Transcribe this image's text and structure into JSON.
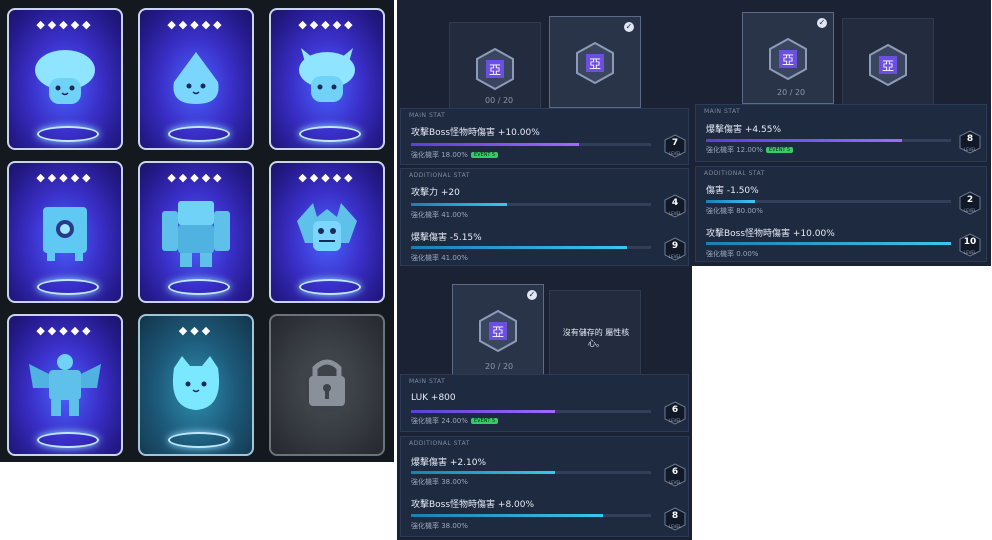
{
  "cards": [
    {
      "stars": "◆◆◆◆◆",
      "monster": "mushroom",
      "locked": false
    },
    {
      "stars": "◆◆◆◆◆",
      "monster": "slime",
      "locked": false
    },
    {
      "stars": "◆◆◆◆◆",
      "monster": "horned-mushroom",
      "locked": false
    },
    {
      "stars": "◆◆◆◆◆",
      "monster": "block-golem",
      "locked": false
    },
    {
      "stars": "◆◆◆◆◆",
      "monster": "stone-golem",
      "locked": false
    },
    {
      "stars": "◆◆◆◆◆",
      "monster": "balrog",
      "locked": false
    },
    {
      "stars": "◆◆◆◆◆",
      "monster": "robot",
      "locked": false
    },
    {
      "stars": "◆◆◆",
      "monster": "cat-slime",
      "locked": false
    },
    {
      "stars": "",
      "monster": "lock-icon",
      "locked": true
    }
  ],
  "panel_a": {
    "count": "00 / 20",
    "main_title": "MAIN STAT",
    "main_stat": "攻擊Boss怪物時傷害 +10.00%",
    "main_sub": "強化機率 18.00%",
    "main_event": "EVENT 5",
    "main_level": "7",
    "main_fill": 0.7,
    "add_title": "ADDITIONAL STAT",
    "add1_stat": "攻擊力 +20",
    "add1_sub": "強化機率 41.00%",
    "add1_level": "4",
    "add1_fill": 0.4,
    "add2_stat": "爆擊傷害 -5.15%",
    "add2_sub": "強化機率 41.00%",
    "add2_level": "9",
    "add2_fill": 0.9,
    "level_label": "LEVEL"
  },
  "panel_b": {
    "count": "20 / 20",
    "main_title": "MAIN STAT",
    "main_stat": "爆擊傷害 +4.55%",
    "main_sub": "強化機率 12.00%",
    "main_event": "EVENT 5",
    "main_level": "8",
    "main_fill": 0.8,
    "add_title": "ADDITIONAL STAT",
    "add1_stat": "傷害 -1.50%",
    "add1_sub": "強化機率 80.00%",
    "add1_level": "2",
    "add1_fill": 0.2,
    "add2_stat": "攻擊Boss怪物時傷害 +10.00%",
    "add2_sub": "強化機率 0.00%",
    "add2_level": "10",
    "add2_fill": 1.0,
    "level_label": "LEVEL"
  },
  "panel_c": {
    "count": "20 / 20",
    "empty_text": "沒有儲存的 屬性核心。",
    "main_title": "MAIN STAT",
    "main_stat": "LUK +800",
    "main_sub": "強化機率 24.00%",
    "main_event": "EVENT 5",
    "main_level": "6",
    "main_fill": 0.6,
    "add_title": "ADDITIONAL STAT",
    "add1_stat": "爆擊傷害 +2.10%",
    "add1_sub": "強化機率 38.00%",
    "add1_level": "6",
    "add1_fill": 0.6,
    "add2_stat": "攻擊Boss怪物時傷害 +8.00%",
    "add2_sub": "強化機率 38.00%",
    "add2_level": "8",
    "add2_fill": 0.8,
    "level_label": "LEVEL"
  }
}
